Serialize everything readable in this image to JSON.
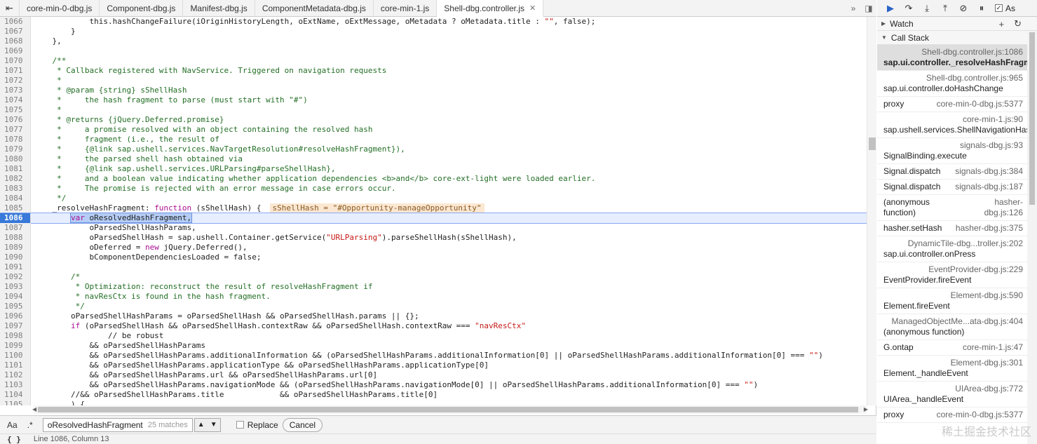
{
  "tabs": [
    {
      "label": "core-min-0-dbg.js"
    },
    {
      "label": "Component-dbg.js"
    },
    {
      "label": "Manifest-dbg.js"
    },
    {
      "label": "ComponentMetadata-dbg.js"
    },
    {
      "label": "core-min-1.js"
    },
    {
      "label": "Shell-dbg.controller.js",
      "active": true
    }
  ],
  "code": {
    "lines": [
      {
        "n": "1066",
        "t": "            this.hashChangeFailure(iOriginHistoryLength, oExtName, oExtMessage, oMetadata ? oMetadata.title : \"\", false);"
      },
      {
        "n": "1067",
        "t": "        }"
      },
      {
        "n": "1068",
        "t": "    },"
      },
      {
        "n": "1069",
        "t": ""
      },
      {
        "n": "1070",
        "t": "    /**",
        "c": true
      },
      {
        "n": "1071",
        "t": "     * Callback registered with NavService. Triggered on navigation requests",
        "c": true
      },
      {
        "n": "1072",
        "t": "     *",
        "c": true
      },
      {
        "n": "1073",
        "t": "     * @param {string} sShellHash",
        "c": true
      },
      {
        "n": "1074",
        "t": "     *     the hash fragment to parse (must start with \"#\")",
        "c": true
      },
      {
        "n": "1075",
        "t": "     *",
        "c": true
      },
      {
        "n": "1076",
        "t": "     * @returns {jQuery.Deferred.promise}",
        "c": true
      },
      {
        "n": "1077",
        "t": "     *     a promise resolved with an object containing the resolved hash",
        "c": true
      },
      {
        "n": "1078",
        "t": "     *     fragment (i.e., the result of",
        "c": true
      },
      {
        "n": "1079",
        "t": "     *     {@link sap.ushell.services.NavTargetResolution#resolveHashFragment}),",
        "c": true
      },
      {
        "n": "1080",
        "t": "     *     the parsed shell hash obtained via",
        "c": true
      },
      {
        "n": "1081",
        "t": "     *     {@link sap.ushell.services.URLParsing#parseShellHash},",
        "c": true
      },
      {
        "n": "1082",
        "t": "     *     and a boolean value indicating whether application dependencies <b>and</b> core-ext-light were loaded earlier.",
        "c": true
      },
      {
        "n": "1083",
        "t": "     *     The promise is rejected with an error message in case errors occur.",
        "c": true
      },
      {
        "n": "1084",
        "t": "     */",
        "c": true
      },
      {
        "n": "1085",
        "t": "    _resolveHashFragment: function (sShellHash) {",
        "inline": "sShellHash = \"#Opportunity-manageOpportunity\""
      },
      {
        "n": "1086",
        "t": "        var oResolvedHashFragment,",
        "exec": true
      },
      {
        "n": "1087",
        "t": "            oParsedShellHashParams,"
      },
      {
        "n": "1088",
        "t": "            oParsedShellHash = sap.ushell.Container.getService(\"URLParsing\").parseShellHash(sShellHash),"
      },
      {
        "n": "1089",
        "t": "            oDeferred = new jQuery.Deferred(),"
      },
      {
        "n": "1090",
        "t": "            bComponentDependenciesLoaded = false;"
      },
      {
        "n": "1091",
        "t": ""
      },
      {
        "n": "1092",
        "t": "        /*",
        "c": true
      },
      {
        "n": "1093",
        "t": "         * Optimization: reconstruct the result of resolveHashFragment if",
        "c": true
      },
      {
        "n": "1094",
        "t": "         * navResCtx is found in the hash fragment.",
        "c": true
      },
      {
        "n": "1095",
        "t": "         */",
        "c": true
      },
      {
        "n": "1096",
        "t": "        oParsedShellHashParams = oParsedShellHash && oParsedShellHash.params || {};"
      },
      {
        "n": "1097",
        "t": "        if (oParsedShellHash && oParsedShellHash.contextRaw && oParsedShellHash.contextRaw === \"navResCtx\""
      },
      {
        "n": "1098",
        "t": "                // be robust"
      },
      {
        "n": "1099",
        "t": "            && oParsedShellHashParams"
      },
      {
        "n": "1100",
        "t": "            && oParsedShellHashParams.additionalInformation && (oParsedShellHashParams.additionalInformation[0] || oParsedShellHashParams.additionalInformation[0] === \"\")"
      },
      {
        "n": "1101",
        "t": "            && oParsedShellHashParams.applicationType && oParsedShellHashParams.applicationType[0]"
      },
      {
        "n": "1102",
        "t": "            && oParsedShellHashParams.url && oParsedShellHashParams.url[0]"
      },
      {
        "n": "1103",
        "t": "            && oParsedShellHashParams.navigationMode && (oParsedShellHashParams.navigationMode[0] || oParsedShellHashParams.additionalInformation[0] === \"\")"
      },
      {
        "n": "1104",
        "t": "        //&& oParsedShellHashParams.title            && oParsedShellHashParams.title[0]"
      },
      {
        "n": "1105",
        "t": "        ) {"
      },
      {
        "n": "1106",
        "t": ""
      }
    ]
  },
  "search": {
    "case_label": "Aa",
    "regex_label": ".*",
    "query": "oResolvedHashFragment",
    "match_count": "25 matches",
    "replace_label": "Replace",
    "cancel_label": "Cancel"
  },
  "status": {
    "braces": "{ }",
    "position": "Line 1086, Column 13"
  },
  "debugger": {
    "async_label": "As",
    "watch_label": "Watch",
    "callstack_label": "Call Stack",
    "frames": [
      {
        "loc": "Shell-dbg.controller.js:1086",
        "fn": "sap.ui.controller._resolveHashFragment",
        "selected": true
      },
      {
        "loc": "Shell-dbg.controller.js:965",
        "fn": "sap.ui.controller.doHashChange"
      },
      {
        "loc": "core-min-0-dbg.js:5377",
        "fn": "proxy",
        "inline": true
      },
      {
        "loc": "core-min-1.js:90",
        "fn": "sap.ushell.services.ShellNavigationHashChanger.treatHashChanged"
      },
      {
        "loc": "signals-dbg.js:93",
        "fn": "SignalBinding.execute"
      },
      {
        "loc": "signals-dbg.js:384",
        "fn": "Signal.dispatch",
        "inline": true
      },
      {
        "loc": "signals-dbg.js:187",
        "fn": "Signal.dispatch",
        "inline": true
      },
      {
        "loc": "hasher-dbg.js:126",
        "fn": "(anonymous function)",
        "inline": true
      },
      {
        "loc": "hasher-dbg.js:375",
        "fn": "hasher.setHash",
        "inline": true
      },
      {
        "loc": "DynamicTile-dbg...troller.js:202",
        "fn": "sap.ui.controller.onPress"
      },
      {
        "loc": "EventProvider-dbg.js:229",
        "fn": "EventProvider.fireEvent"
      },
      {
        "loc": "Element-dbg.js:590",
        "fn": "Element.fireEvent"
      },
      {
        "loc": "ManagedObjectMe...ata-dbg.js:404",
        "fn": "(anonymous function)"
      },
      {
        "loc": "core-min-1.js:47",
        "fn": "G.ontap",
        "inline": true
      },
      {
        "loc": "Element-dbg.js:301",
        "fn": "Element._handleEvent"
      },
      {
        "loc": "UIArea-dbg.js:772",
        "fn": "UIArea._handleEvent"
      },
      {
        "loc": "core-min-0-dbg.js:5377",
        "fn": "proxy",
        "inline": true
      }
    ]
  },
  "watermark": "稀土掘金技术社区",
  "colors": {
    "accent": "#3879d9",
    "comment": "#236e25",
    "string": "#c41a16",
    "keyword": "#aa0d91"
  }
}
